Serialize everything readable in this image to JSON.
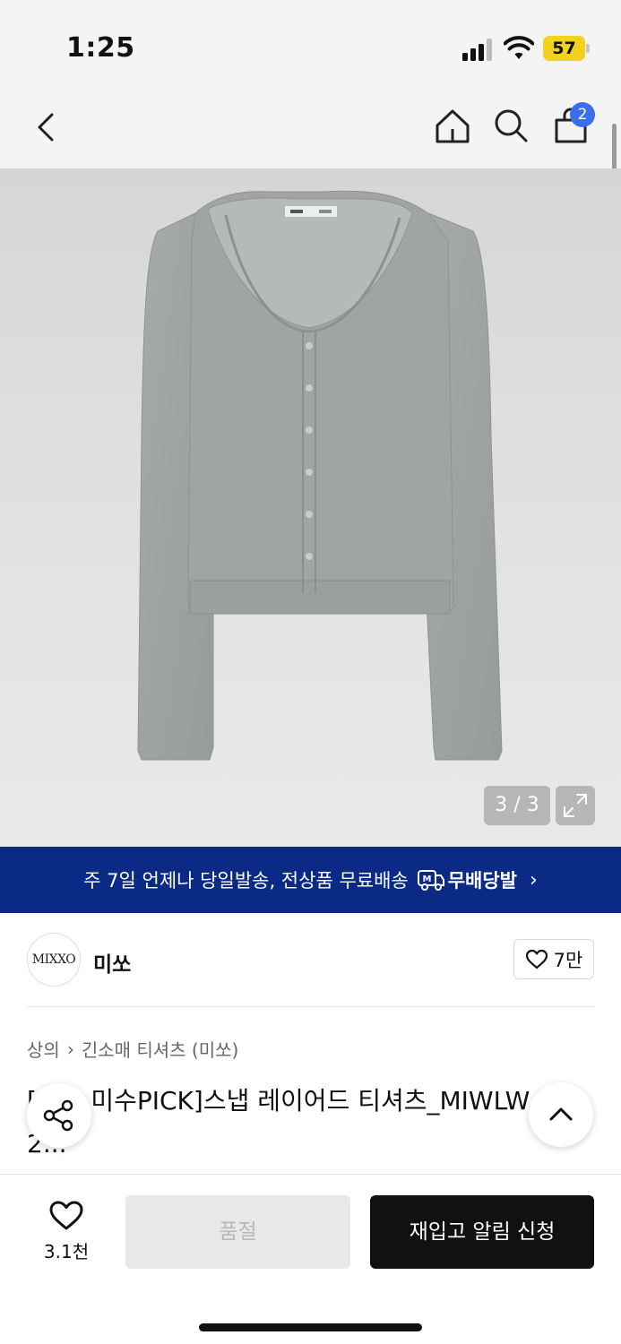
{
  "status_bar": {
    "time": "1:25",
    "battery": "57"
  },
  "nav": {
    "cart_count": "2"
  },
  "gallery": {
    "counter": "3 / 3"
  },
  "banner": {
    "text": "주 7일 언제나 당일발송, 전상품 무료배송",
    "logo_mark": "M",
    "logo_text": "무배당발",
    "chevron": "›"
  },
  "brand": {
    "logo_text": "MIXXO",
    "name": "미쏘",
    "likes": "7만"
  },
  "breadcrumb": {
    "level1": "상의",
    "separator": "›",
    "level2": "긴소매 티셔츠 (미쏘)"
  },
  "product": {
    "title": "[미쏘 미수PICK]스냅 레이어드 티셔츠_MIWLW...2 2..."
  },
  "bottom": {
    "wish_count": "3.1천",
    "soldout_label": "품절",
    "restock_label": "재입고 알림 신청"
  },
  "colors": {
    "banner": "#0b2a85",
    "badge": "#3b6df0",
    "battery": "#f2d21b",
    "primary_button": "#111111"
  }
}
